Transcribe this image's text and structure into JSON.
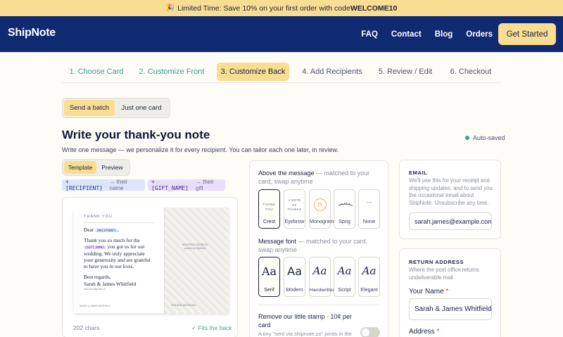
{
  "promo": {
    "emoji": "🎉",
    "text": "Limited Time: Save 10% on your first order with code ",
    "code": "WELCOME10"
  },
  "header": {
    "logo": "ShipNote",
    "nav": [
      "FAQ",
      "Contact",
      "Blog",
      "Orders"
    ],
    "cta": "Get Started"
  },
  "steps": [
    {
      "label": "1. Choose Card"
    },
    {
      "label": "2. Customize Front"
    },
    {
      "label": "3. Customize Back"
    },
    {
      "label": "4. Add Recipients"
    },
    {
      "label": "5. Review / Edit"
    },
    {
      "label": "6. Checkout"
    }
  ],
  "mode": {
    "batch": "Send a batch",
    "single": "Just one card"
  },
  "note": {
    "title": "Write your thank-you note",
    "autosaved": "Auto-saved",
    "subtitle": "Write one message — we personalize it for every recipient. You can tailor each one later, in review."
  },
  "view": {
    "template": "Template",
    "preview": "Preview"
  },
  "chips": {
    "recipient": "+ [RECIPIENT]",
    "recipient_hint": "→ their name",
    "gift": "+ [GIFT_NAME]",
    "gift_hint": "→ their gift"
  },
  "card": {
    "header": "THANK YOU",
    "dear": "Dear ",
    "recipient_tag": "[RECIPIENT]",
    "line1": "Thank you so much for the",
    "gift_tag": "[GIFT_NAME]",
    "line2": " you got us for our wedding. We truly appreciate your generosity and are grateful to have you in our lives.",
    "closing": "Best regards,",
    "signature": "Sarah & James Whitfield",
    "site": "sent via shipnote.co",
    "footer": "SARAH & JAMES WHITFIELD",
    "address": "RECIPIENT ADDRESS",
    "address_sub": "printed by ShipNote",
    "postage": "POSTAGE APPROVED",
    "chars": "202 chars",
    "fits": "✓ Fits the back"
  },
  "above_message": {
    "label": "Above the message",
    "hint": " — matched to your card, swap anytime",
    "options": [
      "Crest",
      "Eyebrow",
      "Monogram",
      "Sprig",
      "None"
    ],
    "crest_text": "THANK YOU",
    "eyebrow_text": "A NOTE OF THANKS",
    "monogram_text": "JS",
    "none_text": "—"
  },
  "message_font": {
    "label": "Message font",
    "hint": " — matched to your card, swap anytime",
    "glyph": "Aa",
    "options": [
      "Serif",
      "Modern",
      "Handwritten",
      "Script",
      "Elegant"
    ]
  },
  "stamp": {
    "label": "Remove our little stamp · 10¢ per card",
    "hint": "A tiny \"sent via shipnote.co\" prints in the"
  },
  "email": {
    "title": "EMAIL",
    "desc": "We'll use this for your receipt and shipping updates, and to send you the occasional email about ShipNote. Unsubscribe any time.",
    "value": "sarah.james@example.com"
  },
  "return_address": {
    "title": "RETURN ADDRESS",
    "desc": "Where the post office returns undeliverable mail",
    "name_label": "Your Name",
    "name_value": "Sarah & James Whitfield",
    "address_label": "Address",
    "required": "*"
  }
}
